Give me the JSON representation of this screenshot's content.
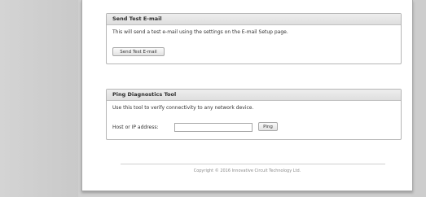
{
  "email_panel": {
    "title": "Send Test E-mail",
    "description": "This will send a test e-mail using the settings on the E-mail Setup page.",
    "button_label": "Send Test E-mail"
  },
  "ping_panel": {
    "title": "Ping Diagnostics Tool",
    "description": "Use this tool to verify connectivity to any network device.",
    "host_label": "Host or IP address:",
    "host_value": "",
    "button_label": "Ping"
  },
  "footer": {
    "copyright": "Copyright © 2016 Innovative Circuit Technology Ltd."
  }
}
